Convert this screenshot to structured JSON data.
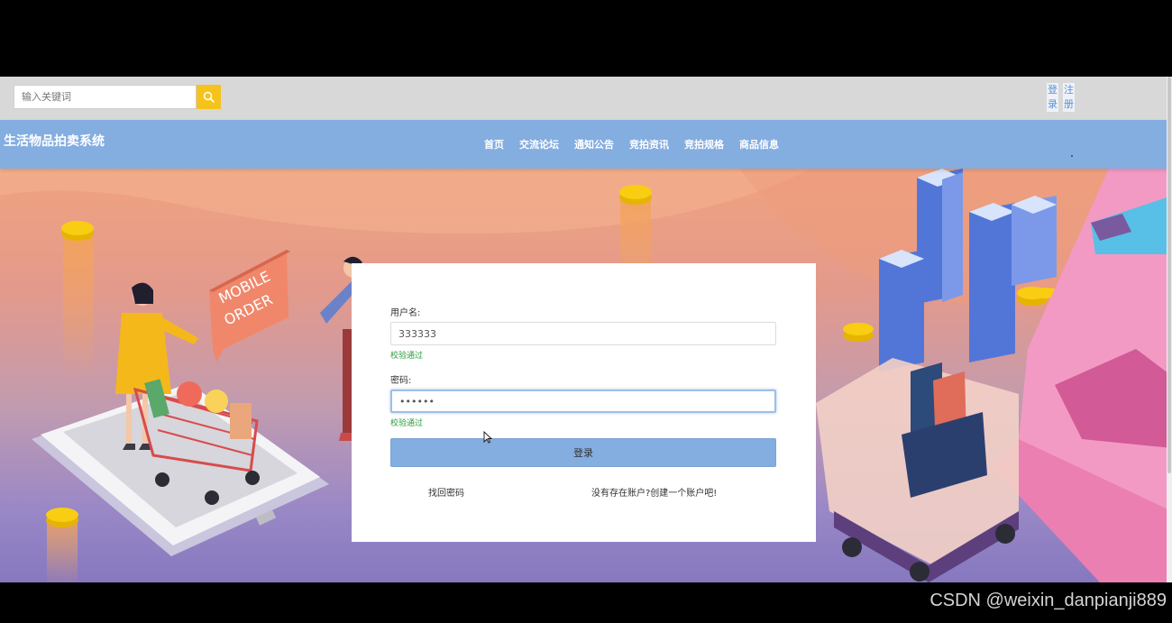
{
  "search": {
    "placeholder": "输入关键词",
    "button_icon": "search-icon"
  },
  "auth": {
    "login": "登录",
    "register": "注册"
  },
  "header": {
    "site_title": "生活物品拍卖系统",
    "nav": [
      "首页",
      "交流论坛",
      "通知公告",
      "竞拍资讯",
      "竞拍规格",
      "商品信息"
    ]
  },
  "hero": {
    "sign_text_line1": "MOBILE",
    "sign_text_line2": "ORDER"
  },
  "login_form": {
    "username_label": "用户名:",
    "username_value": "333333",
    "username_status": "校验通过",
    "password_label": "密码:",
    "password_value": "••••••",
    "password_status": "校验通过",
    "submit_label": "登录",
    "forgot_link": "找回密码",
    "register_link": "没有存在账户?创建一个账户吧!"
  },
  "watermark": "CSDN @weixin_danpianji889",
  "colors": {
    "nav_bg": "#84ade0",
    "search_button": "#f5c31c",
    "valid_text": "#2e9b3f",
    "top_strip": "#d8d8d8"
  }
}
